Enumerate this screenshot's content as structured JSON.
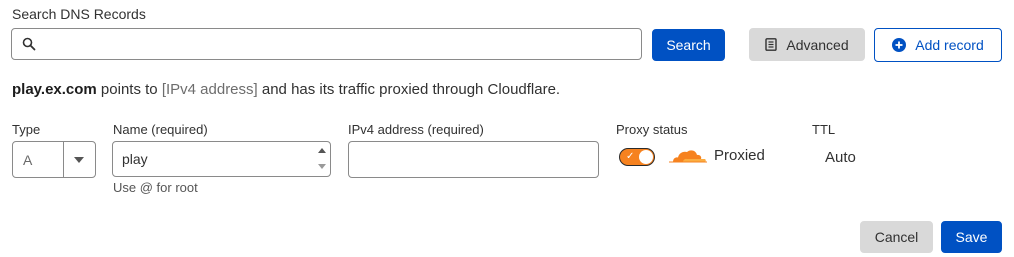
{
  "search": {
    "label": "Search DNS Records",
    "value": "",
    "placeholder": "",
    "button_label": "Search"
  },
  "toolbar": {
    "advanced_label": "Advanced",
    "add_record_label": "Add record"
  },
  "info": {
    "host": "play.ex.com",
    "points_to": " points to ",
    "target_placeholder": "[IPv4 address]",
    "suffix": " and has its traffic proxied through Cloudflare."
  },
  "form": {
    "type_label": "Type",
    "type_value": "A",
    "name_label": "Name (required)",
    "name_value": "play",
    "name_helper": "Use @ for root",
    "ipv4_label": "IPv4 address (required)",
    "ipv4_value": "",
    "proxy_label": "Proxy status",
    "proxy_enabled": true,
    "proxy_status_text": "Proxied",
    "ttl_label": "TTL",
    "ttl_value": "Auto"
  },
  "actions": {
    "cancel_label": "Cancel",
    "save_label": "Save"
  },
  "colors": {
    "primary": "#0051c3",
    "proxy_orange": "#f6821f",
    "neutral_button": "#d9d9d9"
  },
  "icons": {
    "search": "search-icon",
    "advanced": "document-icon",
    "add": "plus-circle-icon",
    "proxy": "cloudflare-cloud-icon"
  }
}
